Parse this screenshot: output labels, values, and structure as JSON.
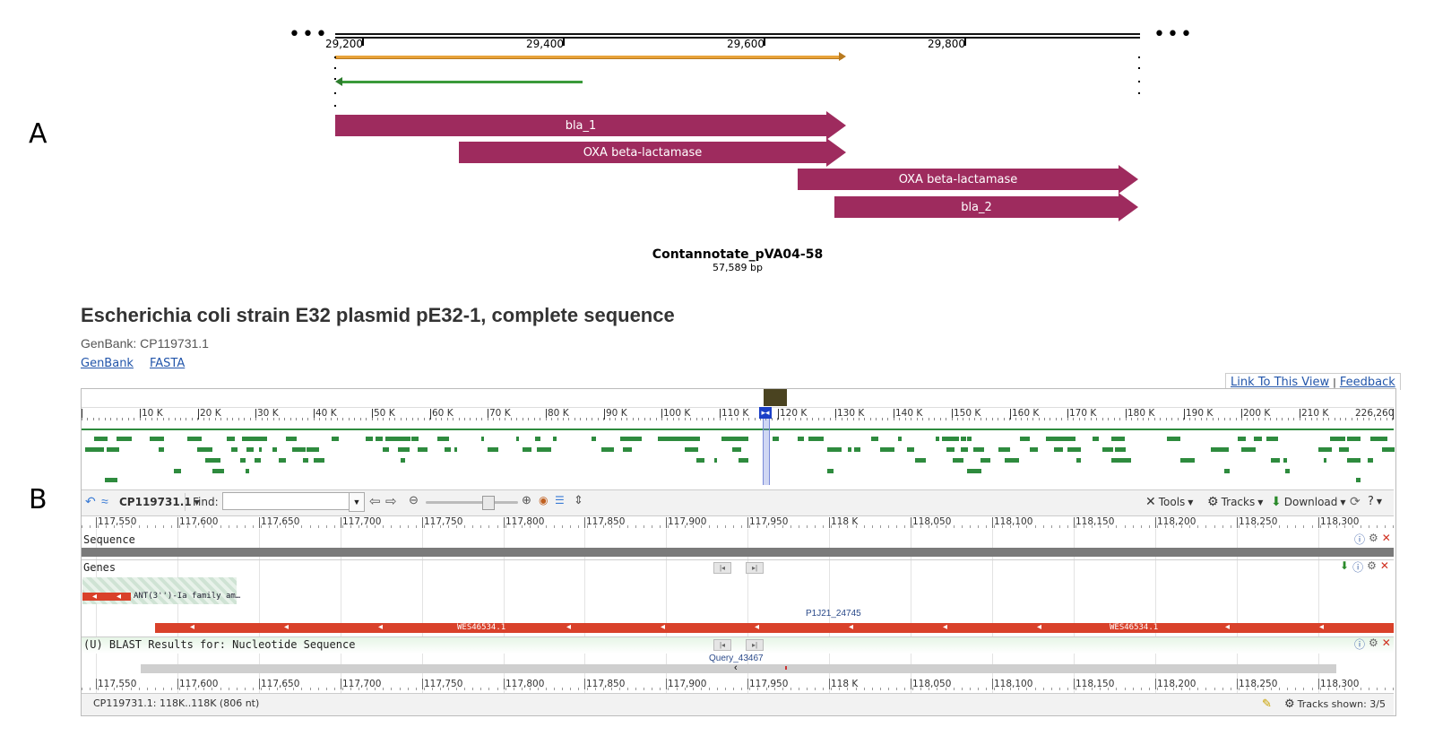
{
  "panel_a": {
    "letter": "A",
    "ruler": [
      "29,200",
      "29,400",
      "29,600",
      "29,800"
    ],
    "features": [
      "bla_1",
      "OXA beta-lactamase",
      "OXA beta-lactamase",
      "bla_2"
    ],
    "title": "Contannotate_pVA04-58",
    "subtitle": "57,589 bp"
  },
  "panel_b": {
    "letter": "B",
    "title": "Escherichia coli strain E32 plasmid pE32-1, complete sequence",
    "accession": "GenBank: CP119731.1",
    "links": [
      "GenBank",
      "FASTA"
    ],
    "top_links": [
      "Link To This View",
      "Feedback"
    ],
    "overview_ticks": [
      "10 K",
      "20 K",
      "30 K",
      "40 K",
      "50 K",
      "60 K",
      "70 K",
      "80 K",
      "90 K",
      "100 K",
      "110 K",
      "120 K",
      "130 K",
      "140 K",
      "150 K",
      "160 K",
      "170 K",
      "180 K",
      "190 K",
      "200 K",
      "210 K",
      "226,260"
    ],
    "toolbar": {
      "seq_id": "CP119731.1",
      "find_label": "Find:",
      "find_value": "",
      "tools": "Tools",
      "tracks": "Tracks",
      "download": "Download"
    },
    "detail_ticks": [
      "117,550",
      "117,600",
      "117,650",
      "117,700",
      "117,750",
      "117,800",
      "117,850",
      "117,900",
      "117,950",
      "118 K",
      "118,050",
      "118,100",
      "118,150",
      "118,200",
      "118,250",
      "118,300"
    ],
    "tracks": {
      "sequence": "Sequence",
      "genes": "Genes",
      "gene_small": "ANT(3'')-Ia family am…",
      "gene_long_top": "P1J21_24745",
      "gene_long_a": "WES46534.1",
      "gene_long_b": "WES46534.1",
      "blast": "(U) BLAST Results for: Nucleotide Sequence",
      "query": "Query_43467"
    },
    "status": {
      "location": "CP119731.1: 118K..118K (806 nt)",
      "tracks_shown": "Tracks shown: 3/5"
    }
  },
  "colors": {
    "feature": "#9e2b5e",
    "orange_track": "#e8a33a",
    "green_track": "#3a9a3a",
    "gene_red": "#d9412a",
    "overview_gene": "#2e8b3e"
  }
}
